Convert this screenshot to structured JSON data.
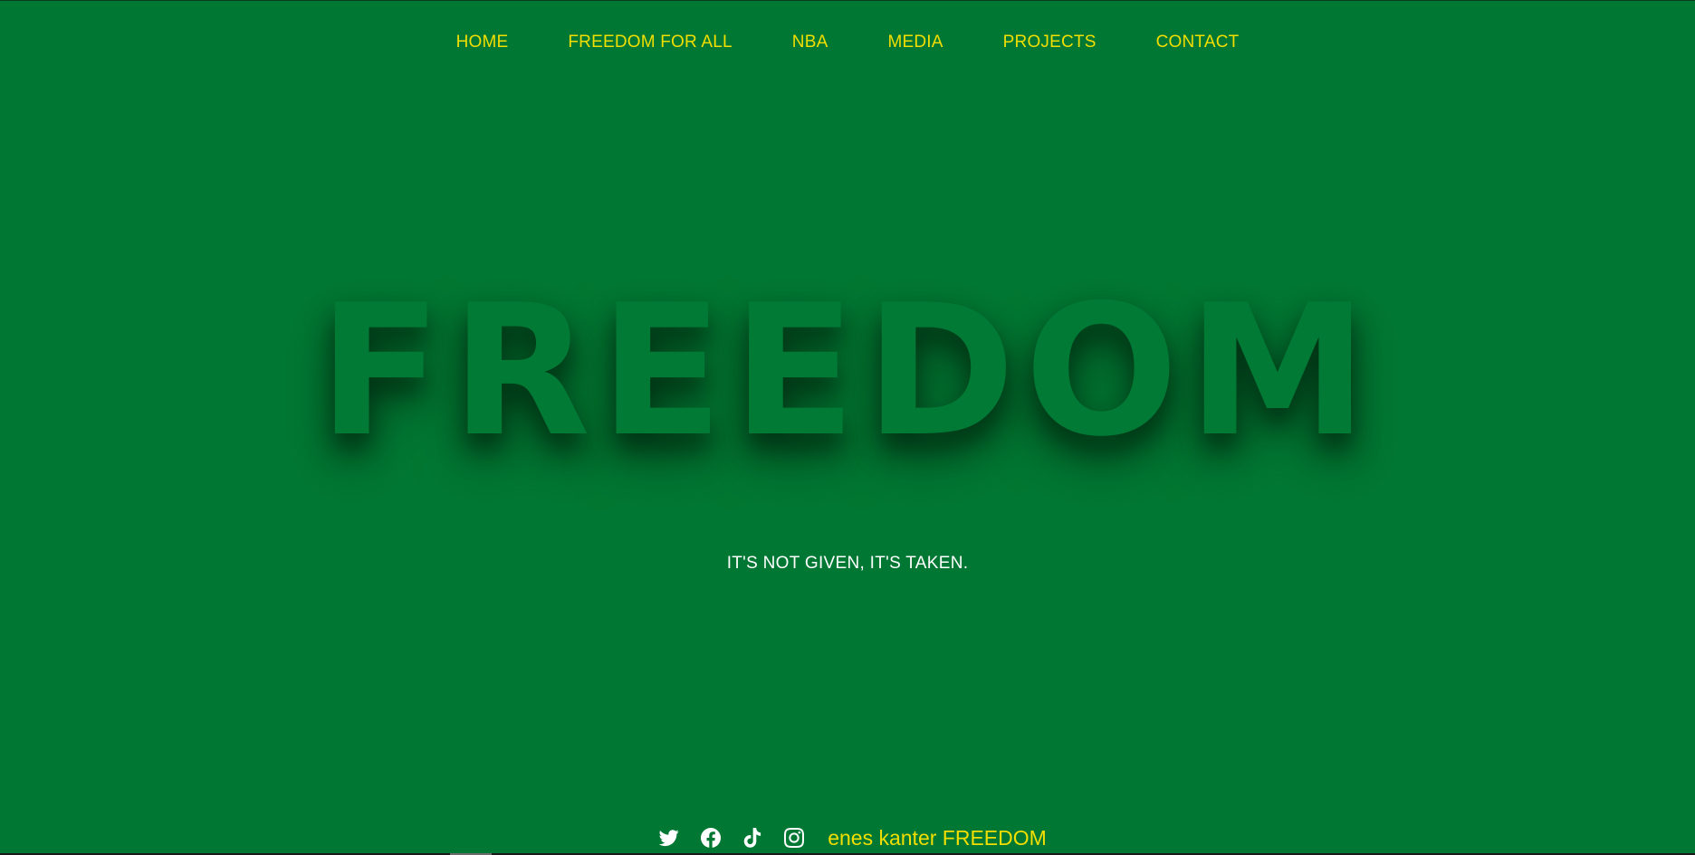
{
  "nav": {
    "items": [
      {
        "label": "HOME"
      },
      {
        "label": "FREEDOM FOR ALL"
      },
      {
        "label": "NBA"
      },
      {
        "label": "MEDIA"
      },
      {
        "label": "PROJECTS"
      },
      {
        "label": "CONTACT"
      }
    ]
  },
  "hero": {
    "title": "FREEDOM",
    "tagline": "IT'S NOT GIVEN, IT'S TAKEN."
  },
  "footer": {
    "icons": [
      "twitter-icon",
      "facebook-icon",
      "tiktok-icon",
      "instagram-icon"
    ],
    "brand": "enes kanter FREEDOM"
  },
  "colors": {
    "background": "#007833",
    "accent": "#f2de00",
    "text": "#ffffff"
  }
}
